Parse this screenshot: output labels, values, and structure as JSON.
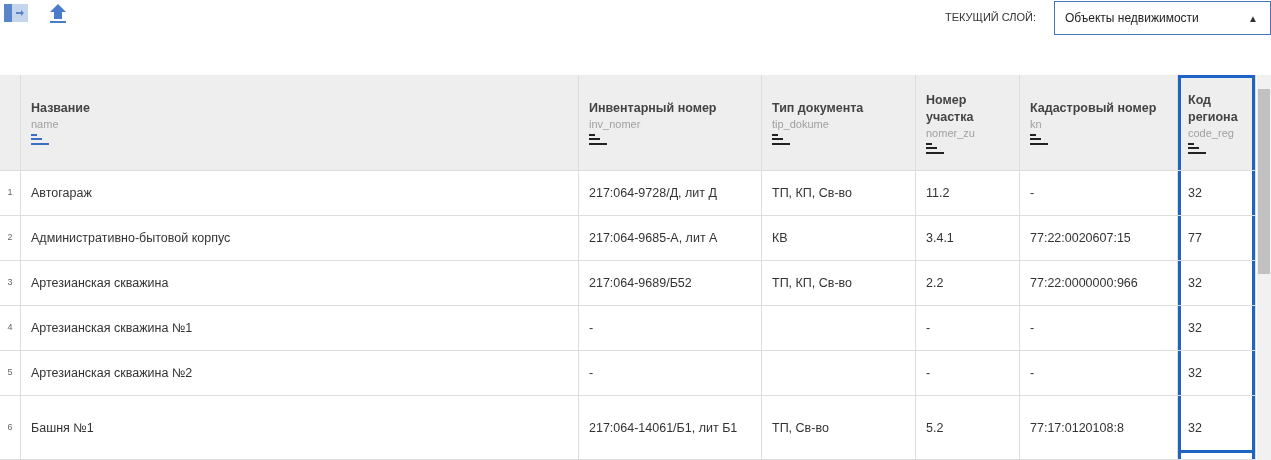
{
  "toolbar": {
    "layer_label": "ТЕКУЩИЙ СЛОЙ:",
    "layer_select": {
      "value": "Объекты недвижимости",
      "caret": "▲"
    }
  },
  "table": {
    "columns": [
      {
        "title": "Название",
        "field": "name",
        "sorted": true,
        "selected": false
      },
      {
        "title": "Инвентарный номер",
        "field": "inv_nomer",
        "sorted": false,
        "selected": false
      },
      {
        "title": "Тип документа",
        "field": "tip_dokume",
        "sorted": false,
        "selected": false
      },
      {
        "title": "Номер участка",
        "field": "nomer_zu",
        "sorted": false,
        "selected": false
      },
      {
        "title": "Кадастровый номер",
        "field": "kn",
        "sorted": false,
        "selected": false
      },
      {
        "title": "Код региона",
        "field": "code_reg",
        "sorted": false,
        "selected": true
      }
    ],
    "rows": [
      {
        "number": "1",
        "cells": [
          "Автогараж",
          "217:064-9728/Д, лит Д",
          "ТП, КП, Св-во",
          "11.2",
          "-",
          "32"
        ]
      },
      {
        "number": "2",
        "cells": [
          "Административно-бытовой корпус",
          "217:064-9685-А, лит А",
          "КВ",
          "3.4.1",
          "77:22:0020607:15",
          "77"
        ]
      },
      {
        "number": "3",
        "cells": [
          "Артезианская скважина",
          "217:064-9689/Б52",
          "ТП, КП, Св-во",
          "2.2",
          "77:22:0000000:966",
          "32"
        ]
      },
      {
        "number": "4",
        "cells": [
          "Артезианская скважина №1",
          "-",
          "",
          "-",
          "-",
          "32"
        ]
      },
      {
        "number": "5",
        "cells": [
          "Артезианская скважина №2",
          "-",
          "",
          "-",
          "-",
          "32"
        ]
      },
      {
        "number": "6",
        "cells": [
          "Башня №1",
          "217:064-14061/Б1, лит Б1",
          "ТП, Св-во",
          "5.2",
          "77:17:0120108:8",
          "32"
        ]
      }
    ]
  }
}
